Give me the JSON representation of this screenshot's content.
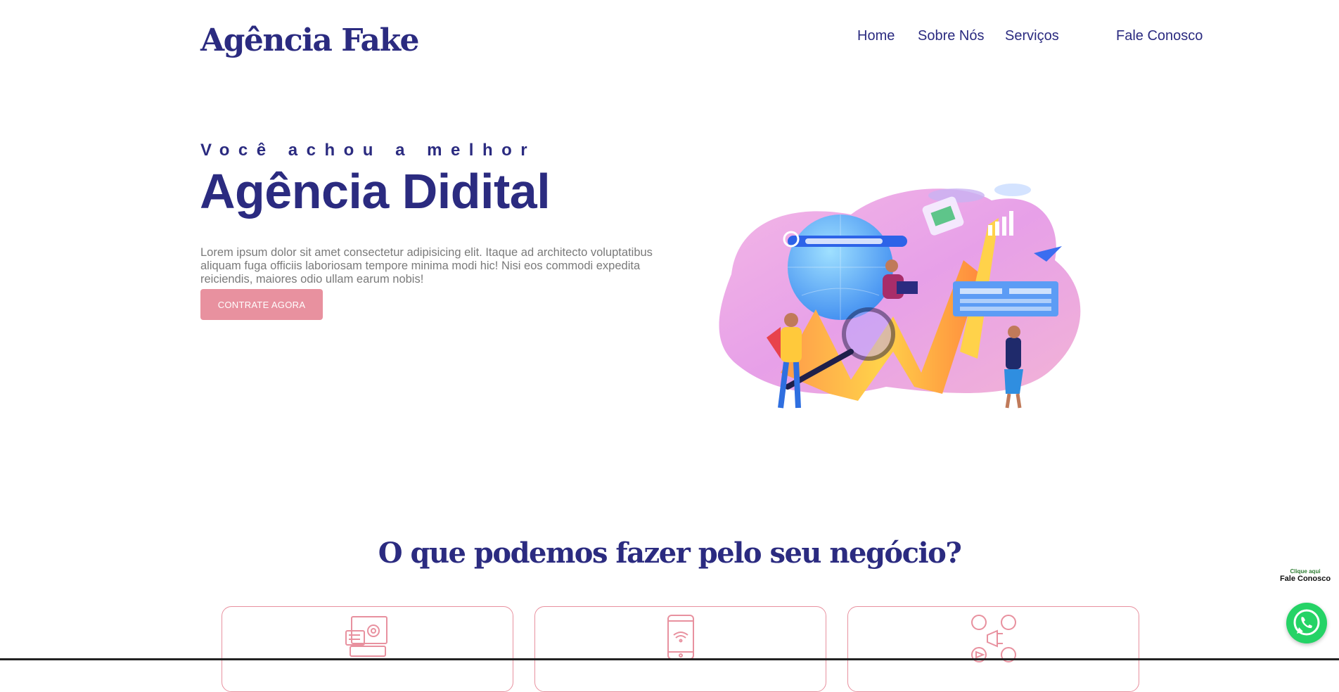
{
  "header": {
    "logo": "Agência Fake",
    "nav": [
      "Home",
      "Sobre Nós",
      "Serviços",
      "Fale Conosco"
    ]
  },
  "hero": {
    "eyebrow": "Você achou a melhor",
    "headline": "Agência Didital",
    "lead": "Lorem ipsum dolor sit amet consectetur adipisicing elit. Itaque ad architecto voluptatibus aliquam fuga officiis laboriosam tempore minima modi hic! Nisi eos commodi expedita reiciendis, maiores odio ullam earum nobis!",
    "cta": "CONTRATE AGORA"
  },
  "services": {
    "title": "O que podemos fazer pelo seu negócio?",
    "cards": [
      {
        "icon": "web-settings-icon"
      },
      {
        "icon": "mobile-wifi-icon"
      },
      {
        "icon": "social-media-icon"
      }
    ]
  },
  "whatsapp": {
    "label_small": "Clique aqui",
    "label": "Fale Conosco",
    "icon": "whatsapp-icon"
  },
  "colors": {
    "brand": "#2b2b80",
    "accent": "#e8919f",
    "text_muted": "#7a7a7a",
    "whatsapp": "#25d366"
  }
}
